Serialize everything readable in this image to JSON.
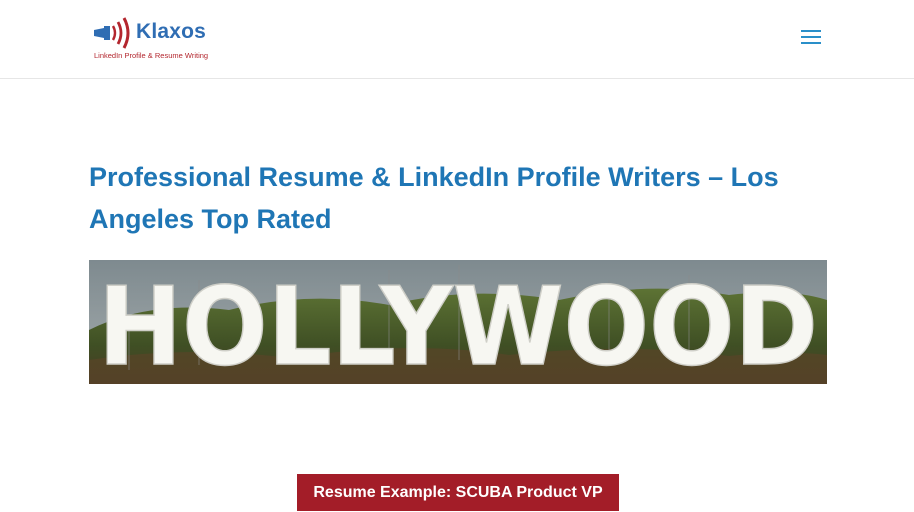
{
  "header": {
    "logo": {
      "name": "Klaxos",
      "tagline": "LinkedIn Profile & Resume Writing",
      "icon": "megaphone-icon"
    },
    "menu_icon": "hamburger-menu-icon"
  },
  "main": {
    "title": "Professional Resume & LinkedIn Profile Writers – Los Angeles Top Rated",
    "banner": {
      "sign_text": "HOLLYWOOD"
    },
    "cta_label": "Resume Example: SCUBA Product VP"
  },
  "colors": {
    "brand_blue": "#1f76b5",
    "brand_red": "#a31d28",
    "menu_blue": "#2a8fc9"
  }
}
